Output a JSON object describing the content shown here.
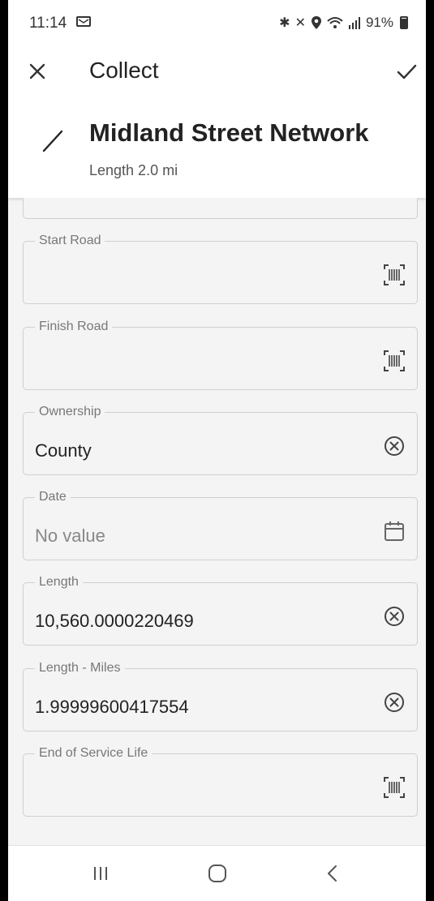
{
  "status_bar": {
    "time": "11:14",
    "icons": [
      "message-icon",
      "bluetooth-icon",
      "mute-icon",
      "location-icon",
      "wifi-icon",
      "signal-icon"
    ],
    "battery": "91%"
  },
  "header": {
    "title": "Collect",
    "feature_name": "Midland Street Network",
    "feature_subtitle": "Length 2.0 mi"
  },
  "form": {
    "fields": [
      {
        "label": "Start Road",
        "value": "",
        "icon": "barcode-scan-icon"
      },
      {
        "label": "Finish Road",
        "value": "",
        "icon": "barcode-scan-icon"
      },
      {
        "label": "Ownership",
        "value": "County",
        "icon": "clear-icon"
      },
      {
        "label": "Date",
        "value": "No value",
        "icon": "calendar-icon"
      },
      {
        "label": "Length",
        "value": "10,560.0000220469",
        "icon": "clear-icon"
      },
      {
        "label": "Length - Miles",
        "value": "1.99999600417554",
        "icon": "clear-icon"
      },
      {
        "label": "End of Service Life",
        "value": "",
        "icon": "barcode-scan-icon"
      }
    ]
  },
  "nav_bar": {
    "buttons": [
      "recent-apps-icon",
      "home-icon",
      "back-icon"
    ]
  }
}
